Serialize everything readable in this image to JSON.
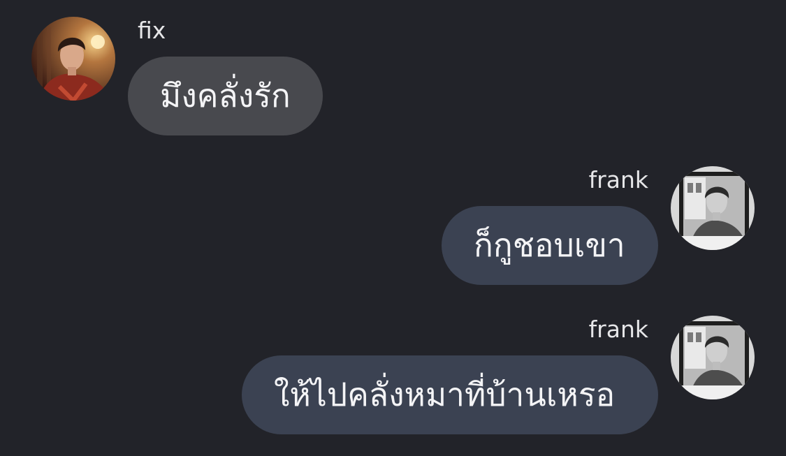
{
  "messages": [
    {
      "sender": "fix",
      "text": "มึงคลั่งรัก",
      "direction": "incoming",
      "avatar": "color-portrait"
    },
    {
      "sender": "frank",
      "text": "ก็กูชอบเขา",
      "direction": "outgoing",
      "avatar": "grayscale-portrait"
    },
    {
      "sender": "frank",
      "text": "ให้ไปคลั่งหมาที่บ้านเหรอ",
      "direction": "outgoing",
      "avatar": "grayscale-portrait"
    }
  ],
  "colors": {
    "background": "#222329",
    "incoming_bubble": "#48494e",
    "outgoing_bubble": "#3b4252",
    "text": "#f4f4f6"
  }
}
